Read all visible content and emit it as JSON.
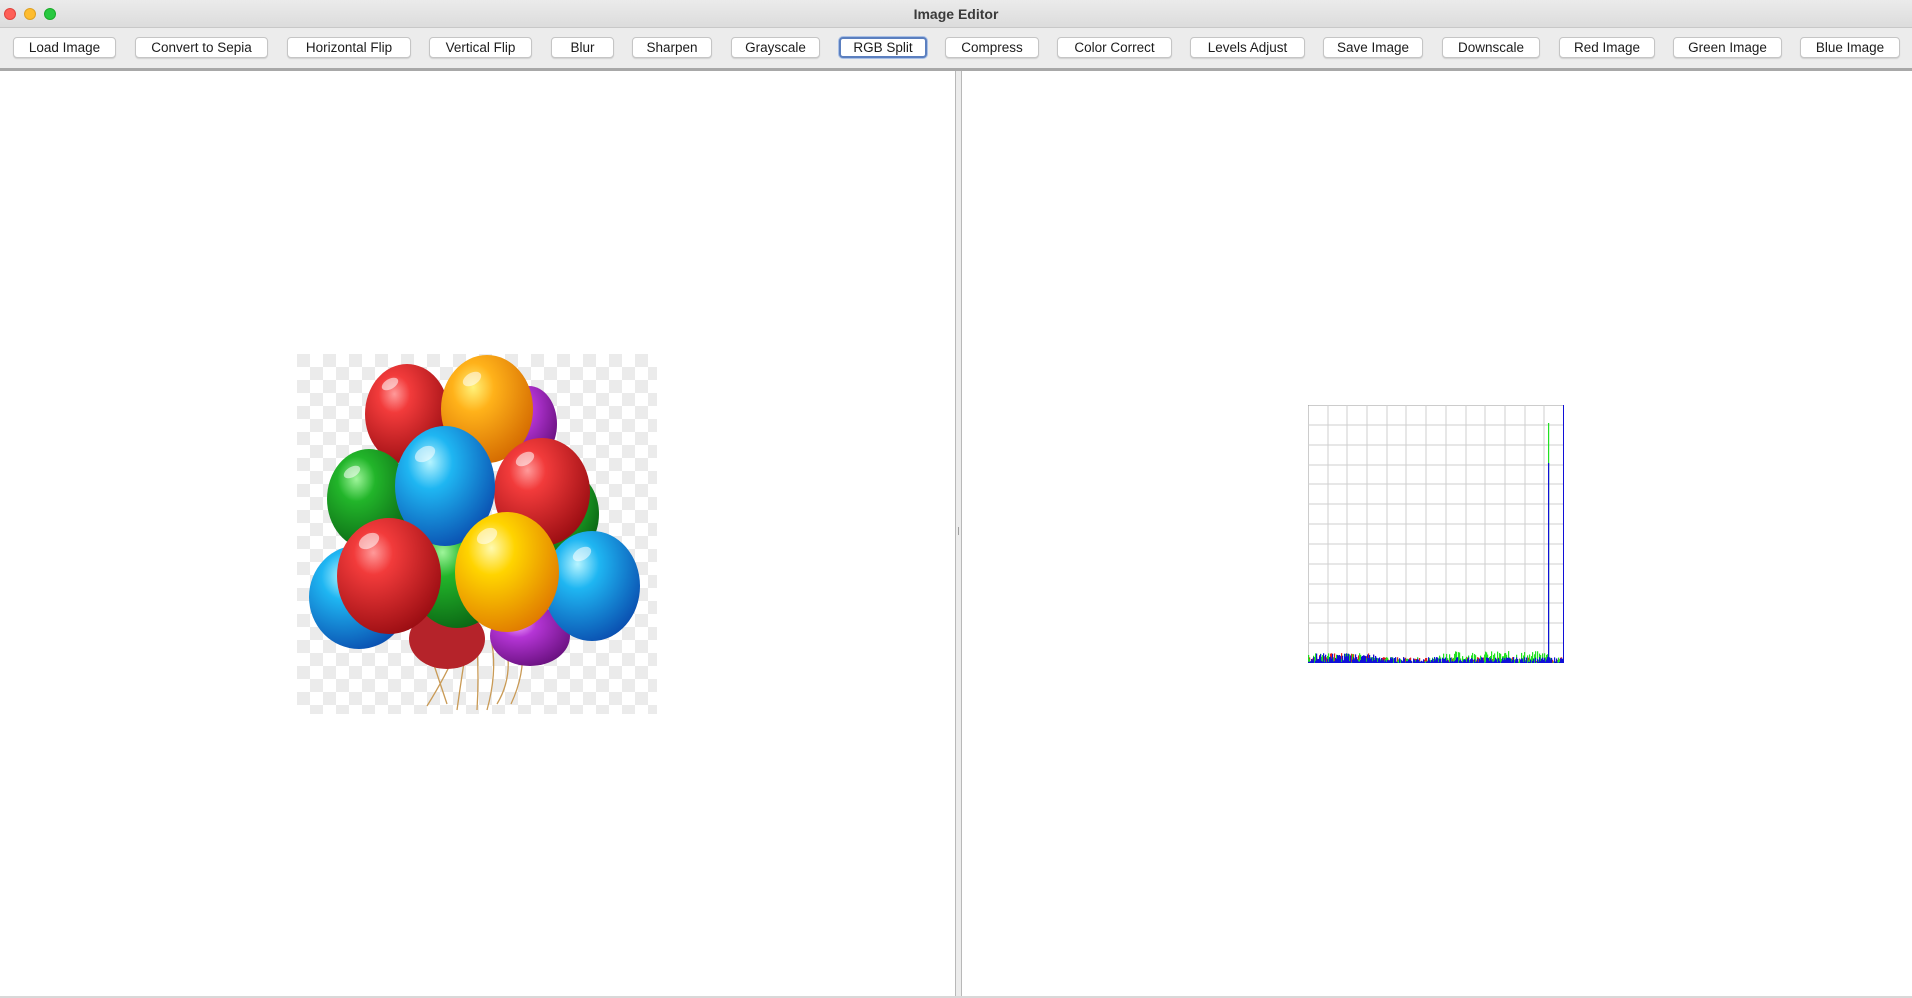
{
  "window": {
    "title": "Image Editor"
  },
  "toolbar": {
    "buttons": [
      {
        "label": "Load Image"
      },
      {
        "label": "Convert to Sepia"
      },
      {
        "label": "Horizontal Flip"
      },
      {
        "label": "Vertical Flip"
      },
      {
        "label": "Blur"
      },
      {
        "label": "Sharpen"
      },
      {
        "label": "Grayscale"
      },
      {
        "label": "RGB Split",
        "focused": true
      },
      {
        "label": "Compress"
      },
      {
        "label": "Color Correct"
      },
      {
        "label": "Levels Adjust"
      },
      {
        "label": "Save Image"
      },
      {
        "label": "Downscale"
      },
      {
        "label": "Red Image"
      },
      {
        "label": "Green Image"
      },
      {
        "label": "Blue Image"
      }
    ]
  },
  "image_panel": {
    "image_subject": "colorful balloons on transparent background"
  },
  "histogram_panel": {
    "series_colors": {
      "red": "#e02020",
      "green": "#22e022",
      "blue": "#1010d8"
    }
  },
  "colors": {
    "focus_ring": "#5b7fbf",
    "panel_bg": "#ffffff",
    "chrome_bg": "#ececec"
  }
}
